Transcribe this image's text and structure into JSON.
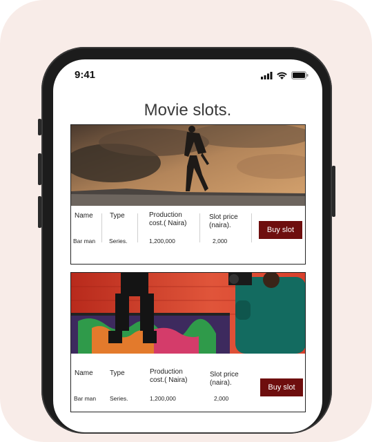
{
  "status_bar": {
    "time": "9:41"
  },
  "page": {
    "title": "Movie slots."
  },
  "slots": [
    {
      "image": "man-walking-on-rocks-clouds",
      "headers": {
        "name": "Name",
        "type": "Type",
        "cost": "Production cost.( Naira)",
        "price": "Slot price (naira)."
      },
      "values": {
        "name": "Bar man",
        "type": "Series.",
        "cost": "1,200,000",
        "price": "2,000"
      },
      "button": "Buy slot"
    },
    {
      "image": "filmmaker-with-camera-graffiti-wall",
      "headers": {
        "name": "Name",
        "type": "Type",
        "cost": "Production cost.( Naira)",
        "price": "Slot price (naira)."
      },
      "values": {
        "name": "Bar man",
        "type": "Series.",
        "cost": "1,200,000",
        "price": "2,000"
      },
      "button": "Buy slot"
    }
  ],
  "colors": {
    "accent": "#6e0e0e",
    "background": "#f8ece8",
    "phone": "#1c1c1c"
  }
}
